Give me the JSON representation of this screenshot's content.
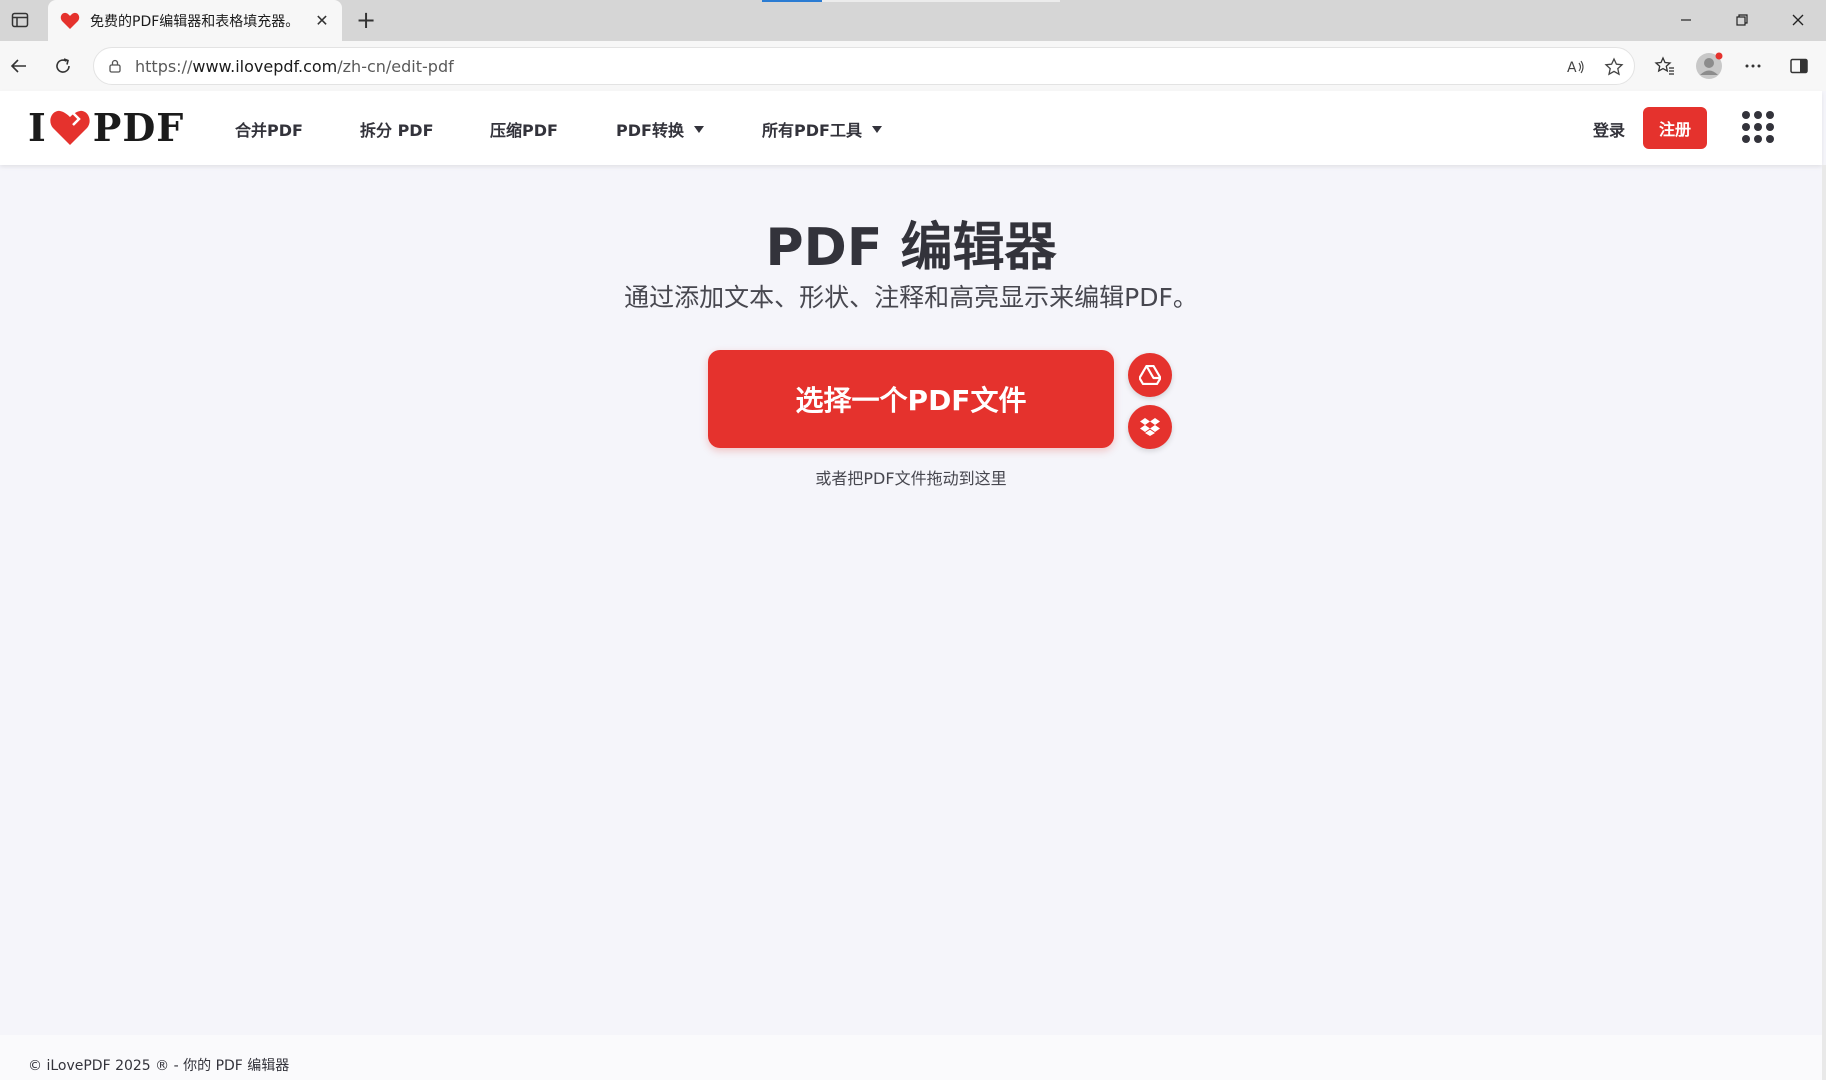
{
  "browser": {
    "tab_title": "免费的PDF编辑器和表格填充器。",
    "url_prefix": "https://",
    "url_host": "www.ilovepdf.com",
    "url_path": "/zh-cn/edit-pdf"
  },
  "header": {
    "logo_left": "I",
    "logo_right": "PDF",
    "nav": [
      {
        "label": "合并PDF"
      },
      {
        "label": "拆分 PDF"
      },
      {
        "label": "压缩PDF"
      },
      {
        "label": "PDF转换"
      },
      {
        "label": "所有PDF工具"
      }
    ],
    "login": "登录",
    "signup": "注册"
  },
  "main": {
    "title": "PDF 编辑器",
    "subtitle": "通过添加文本、形状、注释和高亮显示来编辑PDF。",
    "select_button": "选择一个PDF文件",
    "drop_hint": "或者把PDF文件拖动到这里"
  },
  "footer": {
    "text": "© iLovePDF 2025 ® - 你的 PDF 编辑器"
  },
  "colors": {
    "brand_red": "#e5322d",
    "text_dark": "#33333b",
    "background": "#f5f5fa"
  }
}
